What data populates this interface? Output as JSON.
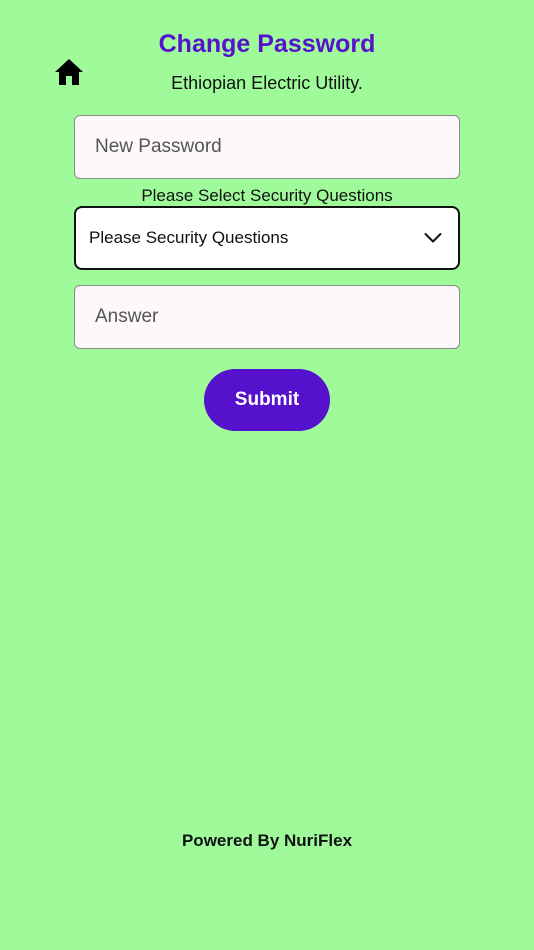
{
  "header": {
    "title": "Change Password",
    "subtitle": "Ethiopian Electric Utility.",
    "home_icon": "home-icon"
  },
  "form": {
    "new_password": {
      "placeholder": "New Password",
      "value": ""
    },
    "security_question": {
      "label": "Please Select Security Questions",
      "selected": "Please Security Questions",
      "icon": "chevron-down-icon"
    },
    "answer": {
      "placeholder": "Answer",
      "value": ""
    },
    "submit_label": "Submit"
  },
  "footer": {
    "text": "Powered By NuriFlex"
  },
  "colors": {
    "background": "#9ffb9a",
    "accent": "#5511cc",
    "field_bg": "#fdf8f9"
  }
}
